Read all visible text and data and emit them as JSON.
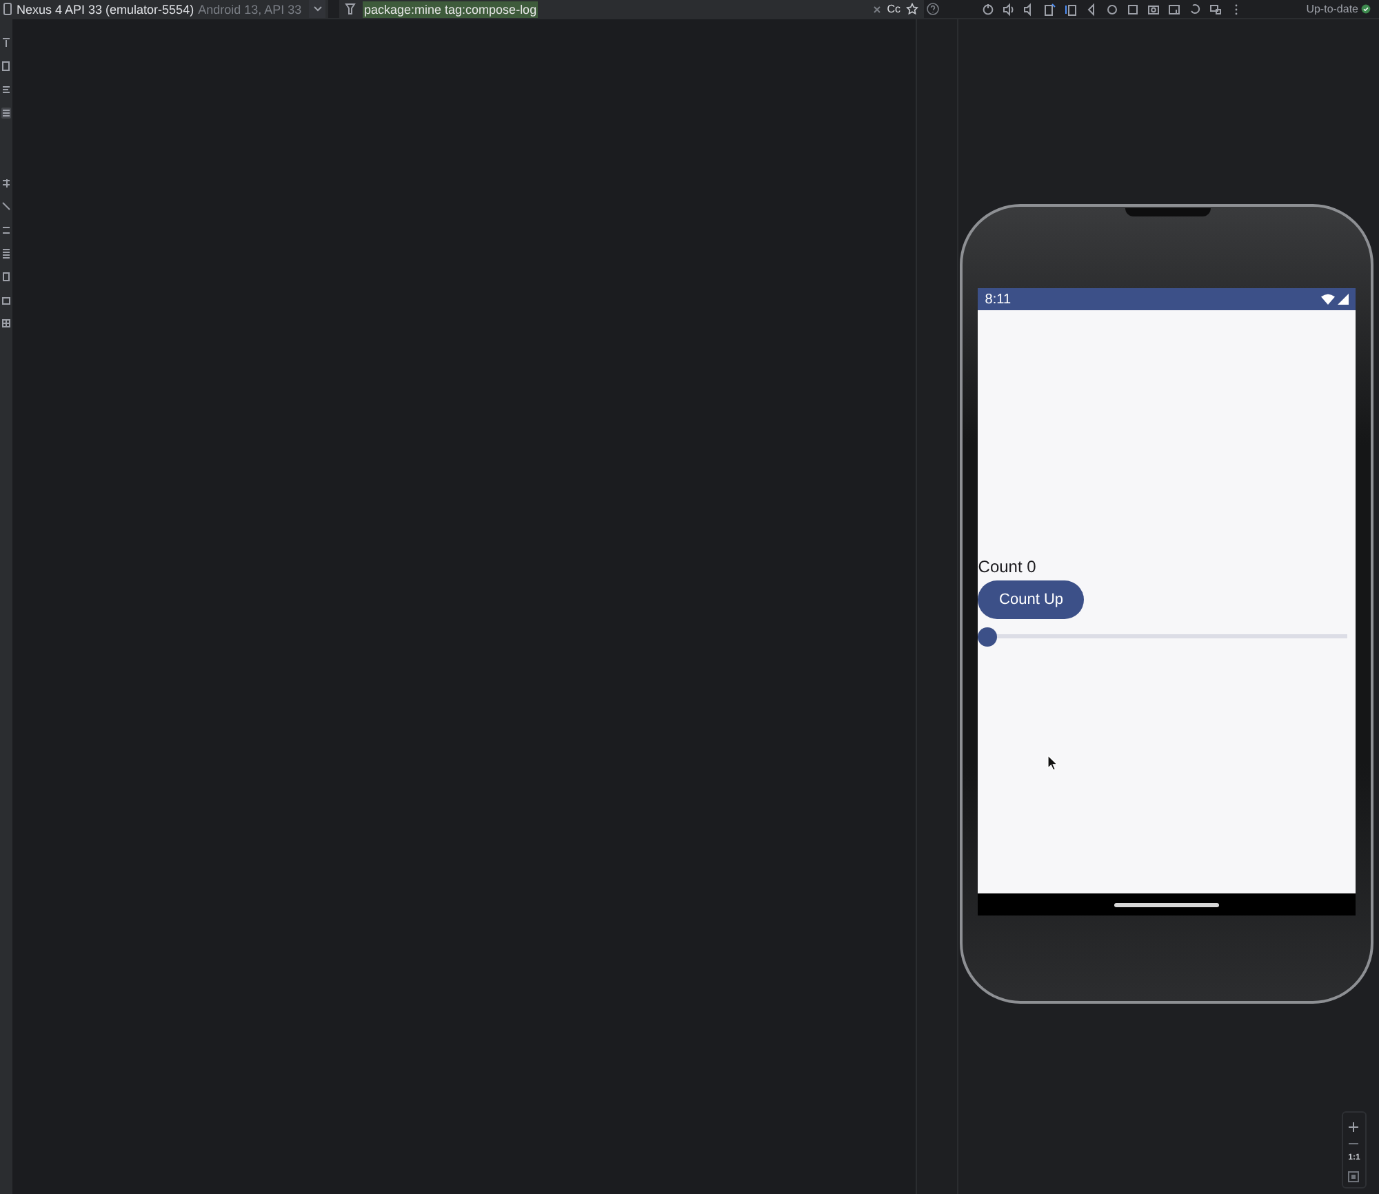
{
  "device_selector": {
    "name": "Nexus 4 API 33 (emulator-5554)",
    "detail": "Android 13, API 33"
  },
  "log_filter": {
    "value": "package:mine tag:compose-log",
    "match_case": "Cc"
  },
  "emulator": {
    "sync_status": "Up-to-date",
    "phone": {
      "status_bar": {
        "time": "8:11"
      },
      "app": {
        "count_label": "Count 0",
        "button": "Count Up",
        "slider": {
          "level": 0
        }
      }
    }
  },
  "zoom_controls": {
    "actual_size": "1:1"
  }
}
